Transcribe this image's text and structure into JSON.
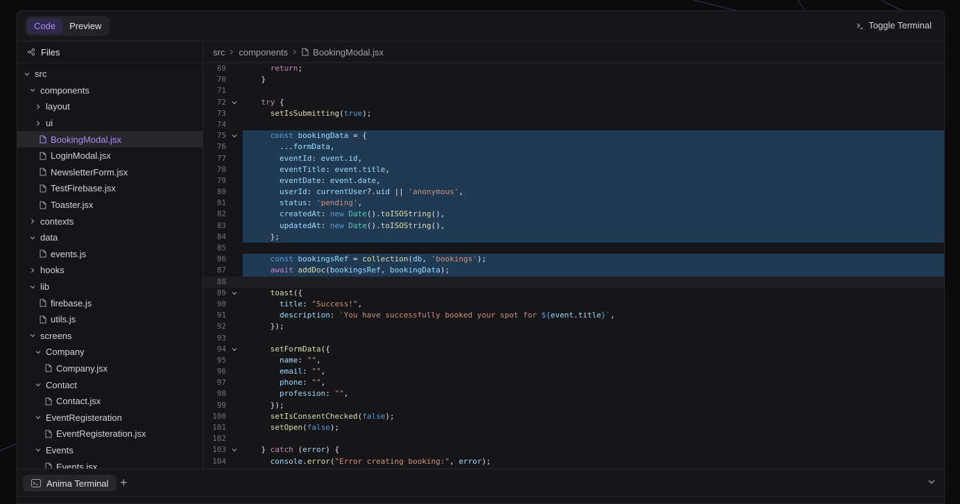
{
  "topbar": {
    "tab_code": "Code",
    "tab_preview": "Preview",
    "toggle_terminal": "Toggle Terminal"
  },
  "sidebar": {
    "title": "Files",
    "tree": [
      {
        "label": "src",
        "type": "folder",
        "open": true,
        "depth": 0
      },
      {
        "label": "components",
        "type": "folder",
        "open": true,
        "depth": 1
      },
      {
        "label": "layout",
        "type": "folder",
        "open": false,
        "depth": 2
      },
      {
        "label": "ui",
        "type": "folder",
        "open": false,
        "depth": 2
      },
      {
        "label": "BookingModal.jsx",
        "type": "file",
        "depth": 2,
        "selected": true
      },
      {
        "label": "LoginModal.jsx",
        "type": "file",
        "depth": 2
      },
      {
        "label": "NewsletterForm.jsx",
        "type": "file",
        "depth": 2
      },
      {
        "label": "TestFirebase.jsx",
        "type": "file",
        "depth": 2
      },
      {
        "label": "Toaster.jsx",
        "type": "file",
        "depth": 2
      },
      {
        "label": "contexts",
        "type": "folder",
        "open": false,
        "depth": 1
      },
      {
        "label": "data",
        "type": "folder",
        "open": true,
        "depth": 1
      },
      {
        "label": "events.js",
        "type": "file",
        "depth": 2
      },
      {
        "label": "hooks",
        "type": "folder",
        "open": false,
        "depth": 1
      },
      {
        "label": "lib",
        "type": "folder",
        "open": true,
        "depth": 1
      },
      {
        "label": "firebase.js",
        "type": "file",
        "depth": 2
      },
      {
        "label": "utils.js",
        "type": "file",
        "depth": 2
      },
      {
        "label": "screens",
        "type": "folder",
        "open": true,
        "depth": 1
      },
      {
        "label": "Company",
        "type": "folder",
        "open": true,
        "depth": 2
      },
      {
        "label": "Company.jsx",
        "type": "file",
        "depth": 3
      },
      {
        "label": "Contact",
        "type": "folder",
        "open": true,
        "depth": 2
      },
      {
        "label": "Contact.jsx",
        "type": "file",
        "depth": 3
      },
      {
        "label": "EventRegisteration",
        "type": "folder",
        "open": true,
        "depth": 2
      },
      {
        "label": "EventRegisteration.jsx",
        "type": "file",
        "depth": 3
      },
      {
        "label": "Events",
        "type": "folder",
        "open": true,
        "depth": 2
      },
      {
        "label": "Events.jsx",
        "type": "file",
        "depth": 3
      }
    ]
  },
  "breadcrumb": [
    "src",
    "components",
    "BookingModal.jsx"
  ],
  "editor": {
    "lines": [
      {
        "n": "69",
        "sel": false,
        "fold": false,
        "tokens": [
          [
            "      ",
            ""
          ],
          [
            "return",
            "kw"
          ],
          [
            ";",
            ""
          ]
        ]
      },
      {
        "n": "70",
        "sel": false,
        "fold": false,
        "tokens": [
          [
            "    }",
            ""
          ]
        ]
      },
      {
        "n": "71",
        "sel": false,
        "fold": false,
        "tokens": [
          [
            "",
            ""
          ]
        ]
      },
      {
        "n": "72",
        "sel": false,
        "fold": true,
        "tokens": [
          [
            "    ",
            ""
          ],
          [
            "try",
            "kw"
          ],
          [
            " {",
            ""
          ]
        ]
      },
      {
        "n": "73",
        "sel": false,
        "fold": false,
        "tokens": [
          [
            "      ",
            ""
          ],
          [
            "setIsSubmitting",
            "fn"
          ],
          [
            "(",
            ""
          ],
          [
            "true",
            "kb"
          ],
          [
            ");",
            ""
          ]
        ]
      },
      {
        "n": "74",
        "sel": false,
        "fold": false,
        "tokens": [
          [
            "",
            ""
          ]
        ]
      },
      {
        "n": "75",
        "sel": true,
        "fold": true,
        "tokens": [
          [
            "      ",
            ""
          ],
          [
            "const",
            "kb"
          ],
          [
            " ",
            ""
          ],
          [
            "bookingData",
            "var"
          ],
          [
            " = {",
            ""
          ]
        ]
      },
      {
        "n": "76",
        "sel": true,
        "fold": false,
        "tokens": [
          [
            "        ...",
            ""
          ],
          [
            "formData",
            "var"
          ],
          [
            ",",
            ""
          ]
        ]
      },
      {
        "n": "77",
        "sel": true,
        "fold": false,
        "tokens": [
          [
            "        ",
            ""
          ],
          [
            "eventId",
            "var"
          ],
          [
            ": ",
            ""
          ],
          [
            "event",
            "var"
          ],
          [
            ".",
            ""
          ],
          [
            "id",
            "var"
          ],
          [
            ",",
            ""
          ]
        ]
      },
      {
        "n": "78",
        "sel": true,
        "fold": false,
        "tokens": [
          [
            "        ",
            ""
          ],
          [
            "eventTitle",
            "var"
          ],
          [
            ": ",
            ""
          ],
          [
            "event",
            "var"
          ],
          [
            ".",
            ""
          ],
          [
            "title",
            "var"
          ],
          [
            ",",
            ""
          ]
        ]
      },
      {
        "n": "79",
        "sel": true,
        "fold": false,
        "tokens": [
          [
            "        ",
            ""
          ],
          [
            "eventDate",
            "var"
          ],
          [
            ": ",
            ""
          ],
          [
            "event",
            "var"
          ],
          [
            ".",
            ""
          ],
          [
            "date",
            "var"
          ],
          [
            ",",
            ""
          ]
        ]
      },
      {
        "n": "80",
        "sel": true,
        "fold": false,
        "tokens": [
          [
            "        ",
            ""
          ],
          [
            "userId",
            "var"
          ],
          [
            ": ",
            ""
          ],
          [
            "currentUser",
            "var"
          ],
          [
            "?.",
            ""
          ],
          [
            "uid",
            "var"
          ],
          [
            " || ",
            ""
          ],
          [
            "'anonymous'",
            "str"
          ],
          [
            ",",
            ""
          ]
        ]
      },
      {
        "n": "81",
        "sel": true,
        "fold": false,
        "tokens": [
          [
            "        ",
            ""
          ],
          [
            "status",
            "var"
          ],
          [
            ": ",
            ""
          ],
          [
            "'pending'",
            "str"
          ],
          [
            ",",
            ""
          ]
        ]
      },
      {
        "n": "82",
        "sel": true,
        "fold": false,
        "tokens": [
          [
            "        ",
            ""
          ],
          [
            "createdAt",
            "var"
          ],
          [
            ": ",
            ""
          ],
          [
            "new",
            "kb"
          ],
          [
            " ",
            ""
          ],
          [
            "Date",
            "cls"
          ],
          [
            "().",
            ""
          ],
          [
            "toISOString",
            "fn"
          ],
          [
            "(),",
            ""
          ]
        ]
      },
      {
        "n": "83",
        "sel": true,
        "fold": false,
        "tokens": [
          [
            "        ",
            ""
          ],
          [
            "updatedAt",
            "var"
          ],
          [
            ": ",
            ""
          ],
          [
            "new",
            "kb"
          ],
          [
            " ",
            ""
          ],
          [
            "Date",
            "cls"
          ],
          [
            "().",
            ""
          ],
          [
            "toISOString",
            "fn"
          ],
          [
            "(),",
            ""
          ]
        ]
      },
      {
        "n": "84",
        "sel": true,
        "fold": false,
        "tokens": [
          [
            "      };",
            ""
          ]
        ]
      },
      {
        "n": "85",
        "sel": true,
        "fold": false,
        "tokens": [
          [
            "",
            ""
          ]
        ]
      },
      {
        "n": "86",
        "sel": true,
        "fold": false,
        "tokens": [
          [
            "      ",
            ""
          ],
          [
            "const",
            "kb"
          ],
          [
            " ",
            ""
          ],
          [
            "bookingsRef",
            "var"
          ],
          [
            " = ",
            ""
          ],
          [
            "collection",
            "fn"
          ],
          [
            "(",
            ""
          ],
          [
            "db",
            "var"
          ],
          [
            ", ",
            ""
          ],
          [
            "'bookings'",
            "str"
          ],
          [
            ");",
            ""
          ]
        ]
      },
      {
        "n": "87",
        "sel": true,
        "fold": false,
        "tokens": [
          [
            "      ",
            ""
          ],
          [
            "await",
            "kw"
          ],
          [
            " ",
            ""
          ],
          [
            "addDoc",
            "fn"
          ],
          [
            "(",
            ""
          ],
          [
            "bookingsRef",
            "var"
          ],
          [
            ", ",
            ""
          ],
          [
            "bookingData",
            "var"
          ],
          [
            ");",
            ""
          ]
        ]
      },
      {
        "n": "88",
        "sel": false,
        "cur": true,
        "fold": false,
        "tokens": [
          [
            "",
            ""
          ]
        ]
      },
      {
        "n": "89",
        "sel": false,
        "fold": true,
        "tokens": [
          [
            "      ",
            ""
          ],
          [
            "toast",
            "fn"
          ],
          [
            "({",
            ""
          ]
        ]
      },
      {
        "n": "90",
        "sel": false,
        "fold": false,
        "tokens": [
          [
            "        ",
            ""
          ],
          [
            "title",
            "var"
          ],
          [
            ": ",
            ""
          ],
          [
            "\"Success!\"",
            "str"
          ],
          [
            ",",
            ""
          ]
        ]
      },
      {
        "n": "91",
        "sel": false,
        "fold": false,
        "tokens": [
          [
            "        ",
            ""
          ],
          [
            "description",
            "var"
          ],
          [
            ": ",
            ""
          ],
          [
            "`You have successfully booked your spot for ",
            "str"
          ],
          [
            "${",
            "kb"
          ],
          [
            "event",
            "var"
          ],
          [
            ".",
            ""
          ],
          [
            "title",
            "var"
          ],
          [
            "}",
            "kb"
          ],
          [
            "`",
            "str"
          ],
          [
            ",",
            ""
          ]
        ]
      },
      {
        "n": "92",
        "sel": false,
        "fold": false,
        "tokens": [
          [
            "      });",
            ""
          ]
        ]
      },
      {
        "n": "93",
        "sel": false,
        "fold": false,
        "tokens": [
          [
            "",
            ""
          ]
        ]
      },
      {
        "n": "94",
        "sel": false,
        "fold": true,
        "tokens": [
          [
            "      ",
            ""
          ],
          [
            "setFormData",
            "fn"
          ],
          [
            "({",
            ""
          ]
        ]
      },
      {
        "n": "95",
        "sel": false,
        "fold": false,
        "tokens": [
          [
            "        ",
            ""
          ],
          [
            "name",
            "var"
          ],
          [
            ": ",
            ""
          ],
          [
            "\"\"",
            "str"
          ],
          [
            ",",
            ""
          ]
        ]
      },
      {
        "n": "96",
        "sel": false,
        "fold": false,
        "tokens": [
          [
            "        ",
            ""
          ],
          [
            "email",
            "var"
          ],
          [
            ": ",
            ""
          ],
          [
            "\"\"",
            "str"
          ],
          [
            ",",
            ""
          ]
        ]
      },
      {
        "n": "97",
        "sel": false,
        "fold": false,
        "tokens": [
          [
            "        ",
            ""
          ],
          [
            "phone",
            "var"
          ],
          [
            ": ",
            ""
          ],
          [
            "\"\"",
            "str"
          ],
          [
            ",",
            ""
          ]
        ]
      },
      {
        "n": "98",
        "sel": false,
        "fold": false,
        "tokens": [
          [
            "        ",
            ""
          ],
          [
            "profession",
            "var"
          ],
          [
            ": ",
            ""
          ],
          [
            "\"\"",
            "str"
          ],
          [
            ",",
            ""
          ]
        ]
      },
      {
        "n": "99",
        "sel": false,
        "fold": false,
        "tokens": [
          [
            "      });",
            ""
          ]
        ]
      },
      {
        "n": "100",
        "sel": false,
        "fold": false,
        "tokens": [
          [
            "      ",
            ""
          ],
          [
            "setIsConsentChecked",
            "fn"
          ],
          [
            "(",
            ""
          ],
          [
            "false",
            "kb"
          ],
          [
            ");",
            ""
          ]
        ]
      },
      {
        "n": "101",
        "sel": false,
        "fold": false,
        "tokens": [
          [
            "      ",
            ""
          ],
          [
            "setOpen",
            "fn"
          ],
          [
            "(",
            ""
          ],
          [
            "false",
            "kb"
          ],
          [
            ");",
            ""
          ]
        ]
      },
      {
        "n": "102",
        "sel": false,
        "fold": false,
        "tokens": [
          [
            "",
            ""
          ]
        ]
      },
      {
        "n": "103",
        "sel": false,
        "fold": true,
        "tokens": [
          [
            "    } ",
            ""
          ],
          [
            "catch",
            "kw"
          ],
          [
            " (",
            ""
          ],
          [
            "error",
            "var"
          ],
          [
            ") {",
            ""
          ]
        ]
      },
      {
        "n": "104",
        "sel": false,
        "fold": false,
        "tokens": [
          [
            "      ",
            ""
          ],
          [
            "console",
            "var"
          ],
          [
            ".",
            ""
          ],
          [
            "error",
            "fn"
          ],
          [
            "(",
            ""
          ],
          [
            "\"Error creating booking:\"",
            "str"
          ],
          [
            ", ",
            ""
          ],
          [
            "error",
            "var"
          ],
          [
            ");",
            ""
          ]
        ]
      }
    ]
  },
  "terminal": {
    "tab_label": "Anima Terminal",
    "add_icon": "plus-icon",
    "collapse_icon": "chevron-down-icon"
  }
}
